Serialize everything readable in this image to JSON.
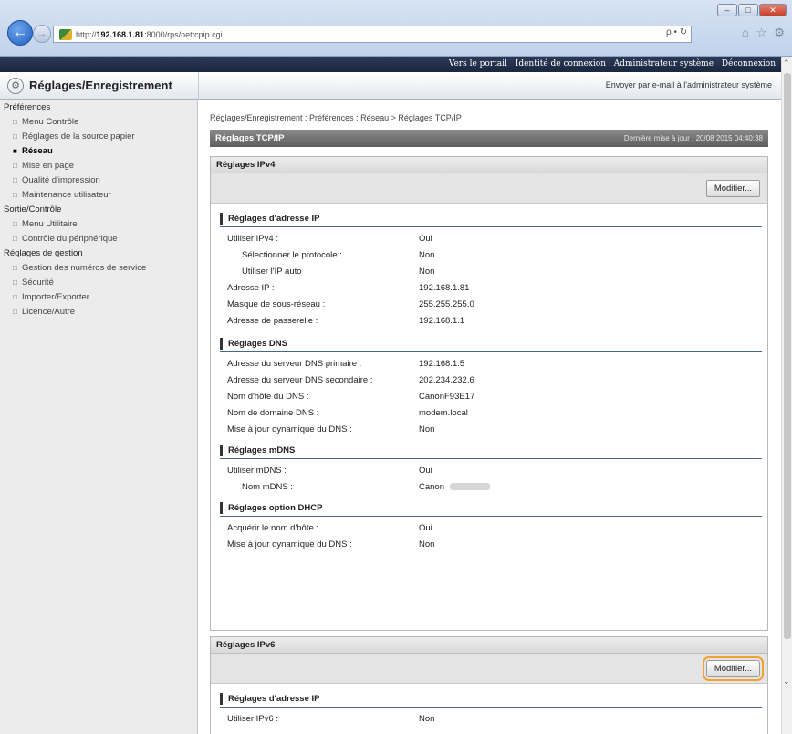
{
  "browser": {
    "url_prefix": "http://",
    "url_host": "192.168.1.81",
    "url_path": ":8000/rps/nettcpip.cgi",
    "search_hint": "ρ • ↻",
    "window_buttons": [
      "–",
      "□",
      "✕"
    ]
  },
  "banner": {
    "left_text": "",
    "links": [
      "Vers le portail",
      "Identité de connexion : Administrateur système",
      "Déconnexion"
    ]
  },
  "header": {
    "title": "Réglages/Enregistrement",
    "email_link": "Envoyer par e-mail à l'administrateur système"
  },
  "sidebar": {
    "groups": [
      {
        "label": "Préférences",
        "items": [
          {
            "label": "Menu Contrôle"
          },
          {
            "label": "Réglages de la source papier"
          },
          {
            "label": "Réseau",
            "active": true
          },
          {
            "label": "Mise en page"
          },
          {
            "label": "Qualité d'impression"
          },
          {
            "label": "Maintenance utilisateur"
          }
        ]
      },
      {
        "label": "Sortie/Contrôle",
        "items": [
          {
            "label": "Menu Utilitaire"
          },
          {
            "label": "Contrôle du périphérique"
          }
        ]
      },
      {
        "label": "Réglages de gestion",
        "items": [
          {
            "label": "Gestion des numéros de service"
          },
          {
            "label": "Sécurité"
          },
          {
            "label": "Importer/Exporter"
          },
          {
            "label": "Licence/Autre"
          }
        ]
      }
    ]
  },
  "main": {
    "breadcrumb": "Réglages/Enregistrement : Préférences : Réseau > Réglages TCP/IP",
    "section_title": "Réglages TCP/IP",
    "last_updated": "Dernière mise à jour : 20/08 2015 04:40:38",
    "ipv4": {
      "title": "Réglages IPv4",
      "edit_label": "Modifier...",
      "ip": {
        "title": "Réglages d'adresse IP",
        "rows": [
          {
            "k": "Utiliser IPv4 :",
            "v": "Oui"
          },
          {
            "k": "Sélectionner le protocole :",
            "v": "Non"
          },
          {
            "k": "Utiliser l'IP auto",
            "v": "Non"
          },
          {
            "k": "Adresse IP :",
            "v": "192.168.1.81"
          },
          {
            "k": "Masque de sous-réseau :",
            "v": "255.255.255.0"
          },
          {
            "k": "Adresse de passerelle :",
            "v": "192.168.1.1"
          }
        ]
      },
      "dns": {
        "title": "Réglages DNS",
        "rows": [
          {
            "k": "Adresse du serveur DNS primaire :",
            "v": "192.168.1.5"
          },
          {
            "k": "Adresse du serveur DNS secondaire :",
            "v": "202.234.232.6"
          },
          {
            "k": "Nom d'hôte du DNS :",
            "v": "CanonF93E17"
          },
          {
            "k": "Nom de domaine DNS :",
            "v": "modem.local"
          },
          {
            "k": "Mise à jour dynamique du DNS :",
            "v": "Non"
          }
        ]
      },
      "mdns": {
        "title": "Réglages mDNS",
        "rows": [
          {
            "k": "Utiliser mDNS :",
            "v": "Oui"
          },
          {
            "k": "Nom mDNS :",
            "v": "Canon"
          }
        ]
      },
      "dhcp": {
        "title": "Réglages option DHCP",
        "rows": [
          {
            "k": "Acquérir le nom d'hôte :",
            "v": "Oui"
          },
          {
            "k": "Mise à jour dynamique du DNS :",
            "v": "Non"
          }
        ]
      }
    },
    "ipv6": {
      "title": "Réglages IPv6",
      "edit_label": "Modifier...",
      "ip": {
        "title": "Réglages d'adresse IP",
        "rows": [
          {
            "k": "Utiliser IPv6 :",
            "v": "Non"
          }
        ]
      }
    }
  }
}
